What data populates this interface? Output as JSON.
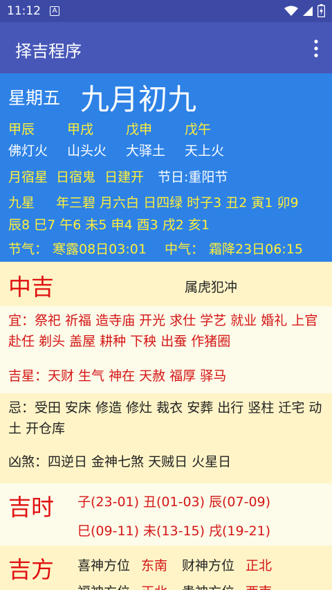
{
  "status": {
    "time": "11:12",
    "notif_letter": "A"
  },
  "app": {
    "title": "择吉程序"
  },
  "header": {
    "weekday": "星期五",
    "lunar_date": "九月初九"
  },
  "ganzhi": [
    "甲辰",
    "甲戌",
    "戊申",
    "戊午"
  ],
  "nayin": [
    "佛灯火",
    "山头火",
    "大驿土",
    "天上火"
  ],
  "lodges": {
    "month": "月宿星",
    "day": "日宿鬼",
    "jianchu": "日建开",
    "festival": "节日:重阳节"
  },
  "ninestar": {
    "label": "九星",
    "line1": "年三碧 月六白 日四绿 时子3 丑2 寅1 卯9",
    "line2": "辰8 巳7 午6 未5 申4 酉3 戌2 亥1"
  },
  "solar_terms": {
    "jieqi_label": "节气：",
    "jieqi_value": "寒露08日03:01",
    "zhongqi_label": "中气：",
    "zhongqi_value": "霜降23日06:15"
  },
  "rating": {
    "level": "中吉",
    "clash": "属虎犯冲"
  },
  "yi": {
    "label": "宜：",
    "text": "祭祀 祈福 造寺庙 开光 求仕 学艺 就业 婚礼 上官 赴任 剃头 盖屋 耕种 下秧 出蚕 作猪圈"
  },
  "jixing": {
    "label": "吉星：",
    "text": "天财 生气 神在 天赦 福厚 驿马"
  },
  "ji": {
    "label": "忌：",
    "text": "受田 安床 修造 修灶 裁衣 安葬 出行 竖柱 迁宅 动土 开仓库"
  },
  "xiongsha": {
    "label": "凶煞：",
    "text": "四逆日 金神七煞 天贼日 火星日"
  },
  "jishi": {
    "label": "吉时",
    "hours": [
      "子(23-01)",
      "丑(01-03)",
      "辰(07-09)",
      "巳(09-11)",
      "未(13-15)",
      "戌(19-21)"
    ]
  },
  "jifang": {
    "label": "吉方",
    "xishen_label": "喜神方位",
    "xishen_value": "东南",
    "caishen_label": "财神方位",
    "caishen_value": "正北",
    "fushen_label": "福神方位",
    "fushen_value": "正北",
    "guishen_label": "贵神方位",
    "guishen_value": "西南"
  },
  "colors": {
    "statusbar": "#3c4aa6",
    "appbar": "#4757b8",
    "info_bg": "#2e82e6",
    "accent_red": "#e01010",
    "accent_yellow": "#ffef3a"
  }
}
